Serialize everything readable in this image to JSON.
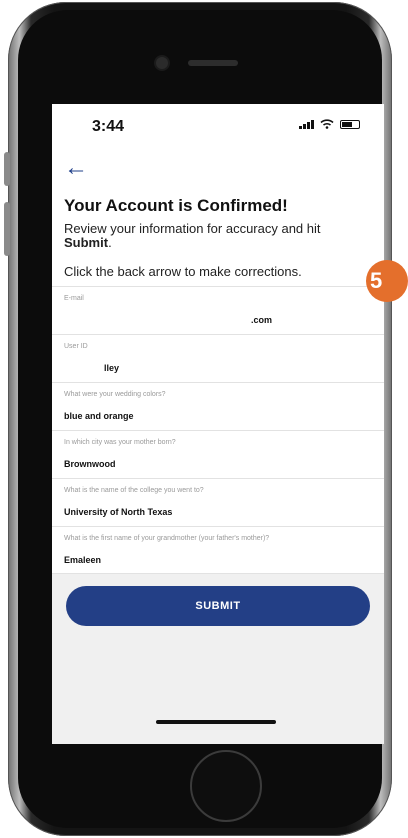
{
  "status_bar": {
    "time": "3:44"
  },
  "header": {
    "back_glyph": "←",
    "title": "Your Account is Confirmed!",
    "desc_pre": "Review your information for accuracy and hit ",
    "desc_bold": "Submit",
    "desc_post": ".",
    "hint": "Click the back arrow to make corrections."
  },
  "fields": [
    {
      "label": "E-mail",
      "value": ".com"
    },
    {
      "label": "User ID",
      "value": "lley"
    },
    {
      "label": "What were your wedding colors?",
      "value": "blue and orange"
    },
    {
      "label": "In which city was your mother born?",
      "value": "Brownwood"
    },
    {
      "label": "What is the name of the college you went to?",
      "value": "University of North Texas"
    },
    {
      "label": "What is the first name of your grandmother (your father's mother)?",
      "value": "Emaleen"
    }
  ],
  "submit_label": "SUBMIT",
  "step_badge": "5",
  "colors": {
    "accent": "#233f86",
    "badge": "#e46f2c"
  },
  "icons": [
    "back-arrow-icon",
    "signal-icon",
    "wifi-icon",
    "battery-icon"
  ]
}
